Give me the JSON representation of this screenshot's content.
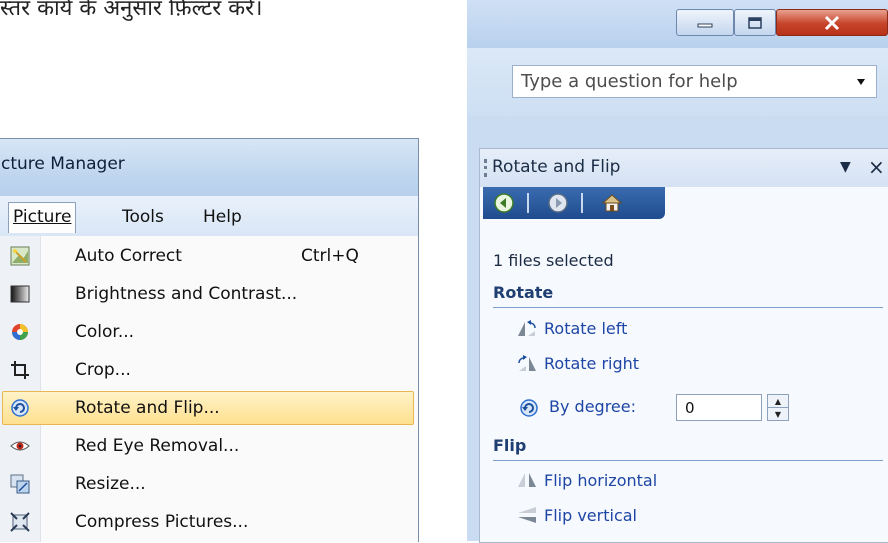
{
  "top_text": "स्तर कार्य के अनुसार फ़िल्टर करें।",
  "picture_manager": {
    "window_title": "cture Manager",
    "menubar": [
      {
        "label": "Picture",
        "open": true
      },
      {
        "label": "Tools",
        "open": false
      },
      {
        "label": "Help",
        "open": false
      }
    ],
    "menu_items": [
      {
        "label": "Auto Correct",
        "shortcut": "Ctrl+Q",
        "icon": "auto-correct-icon",
        "highlighted": false
      },
      {
        "label": "Brightness and Contrast...",
        "shortcut": "",
        "icon": "brightness-icon",
        "highlighted": false
      },
      {
        "label": "Color...",
        "shortcut": "",
        "icon": "color-icon",
        "highlighted": false
      },
      {
        "label": "Crop...",
        "shortcut": "",
        "icon": "crop-icon",
        "highlighted": false
      },
      {
        "label": "Rotate and Flip...",
        "shortcut": "",
        "icon": "rotate-icon",
        "highlighted": true
      },
      {
        "label": "Red Eye Removal...",
        "shortcut": "",
        "icon": "red-eye-icon",
        "highlighted": false
      },
      {
        "label": "Resize...",
        "shortcut": "",
        "icon": "resize-icon",
        "highlighted": false
      },
      {
        "label": "Compress Pictures...",
        "shortcut": "",
        "icon": "compress-icon",
        "highlighted": false
      }
    ],
    "highlight_color": "#ffe08f"
  },
  "help": {
    "placeholder": "Type a question for help"
  },
  "task_pane": {
    "title": "Rotate and Flip",
    "files_selected": "1 files selected",
    "rotate_heading": "Rotate",
    "rotate_left": "Rotate left",
    "rotate_right": "Rotate right",
    "by_degree_label": "By degree:",
    "by_degree_value": "0",
    "flip_heading": "Flip",
    "flip_horizontal": "Flip horizontal",
    "flip_vertical": "Flip vertical",
    "nav_icons": [
      "back-icon",
      "forward-icon",
      "home-icon"
    ],
    "link_color": "#1e46a6",
    "heading_color": "#1f3e72"
  }
}
